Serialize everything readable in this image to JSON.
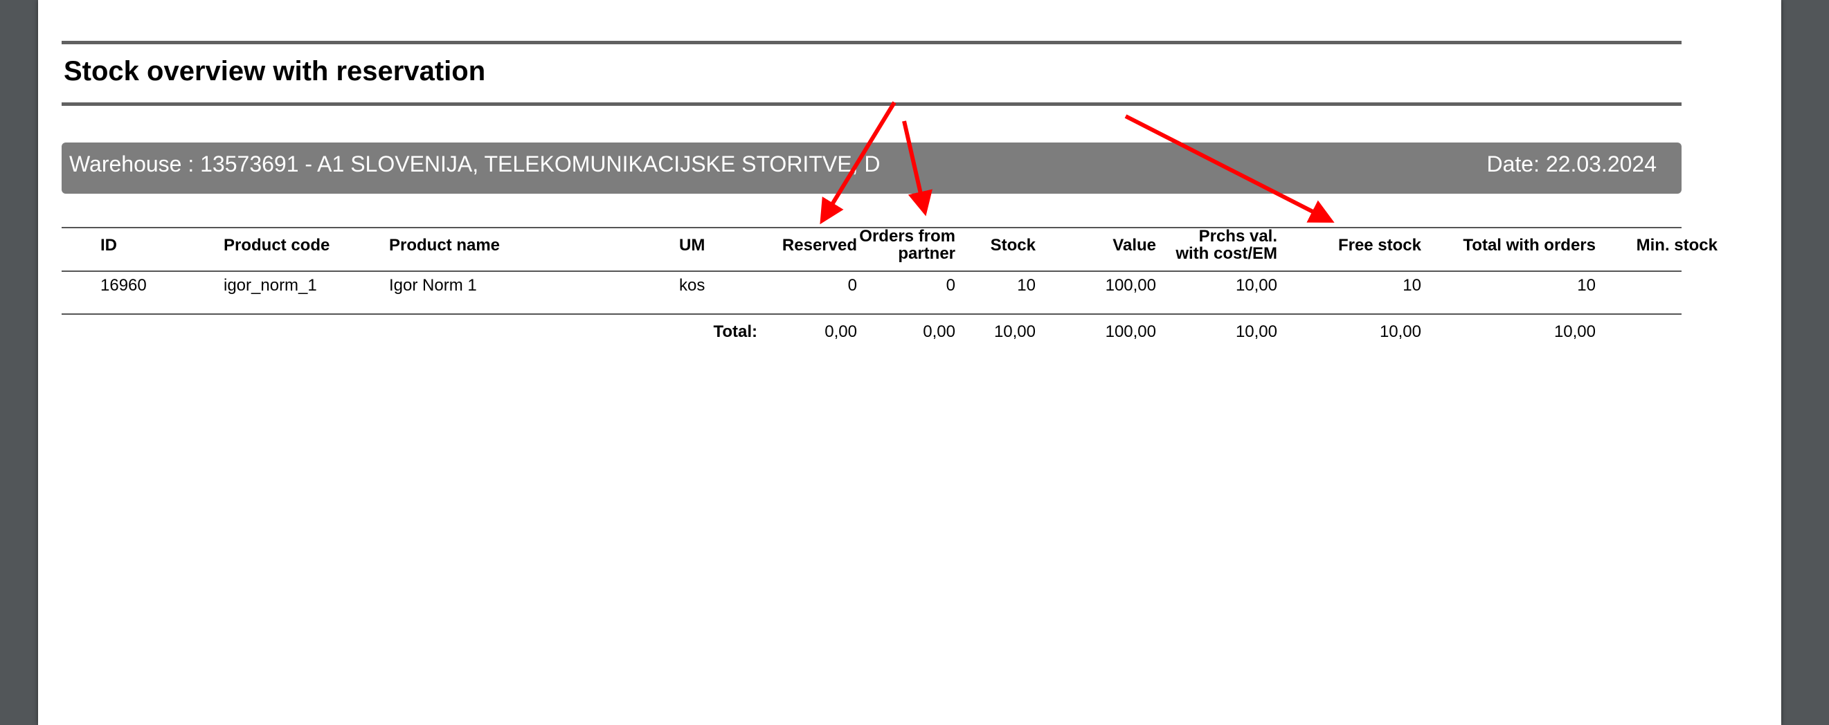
{
  "report": {
    "title": "Stock overview with reservation",
    "warehouse_label": "Warehouse : 13573691 - A1 SLOVENIJA, TELEKOMUNIKACIJSKE STORITVE, D",
    "date_label": "Date: 22.03.2024"
  },
  "table": {
    "headers": {
      "id": "ID",
      "product_code": "Product code",
      "product_name": "Product name",
      "um": "UM",
      "reserved": "Reserved",
      "orders_from_partner_1": "Orders from",
      "orders_from_partner_2": "partner",
      "stock": "Stock",
      "value": "Value",
      "prchs_val_1": "Prchs val.",
      "prchs_val_2": "with cost/EM",
      "free_stock": "Free stock",
      "total_with_orders": "Total with orders",
      "min_stock": "Min. stock"
    },
    "rows": [
      {
        "id": "16960",
        "product_code": "igor_norm_1",
        "product_name": "Igor Norm 1",
        "um": "kos",
        "reserved": "0",
        "orders_from_partner": "0",
        "stock": "10",
        "value": "100,00",
        "prchs_val": "10,00",
        "free_stock": "10",
        "total_with_orders": "10",
        "min_stock": ""
      }
    ],
    "totals": {
      "label": "Total:",
      "reserved": "0,00",
      "orders_from_partner": "0,00",
      "stock": "10,00",
      "value": "100,00",
      "prchs_val": "10,00",
      "free_stock": "10,00",
      "total_with_orders": "10,00"
    }
  },
  "annotations": {
    "arrow_color": "#ff0000",
    "arrow_count": 3
  }
}
